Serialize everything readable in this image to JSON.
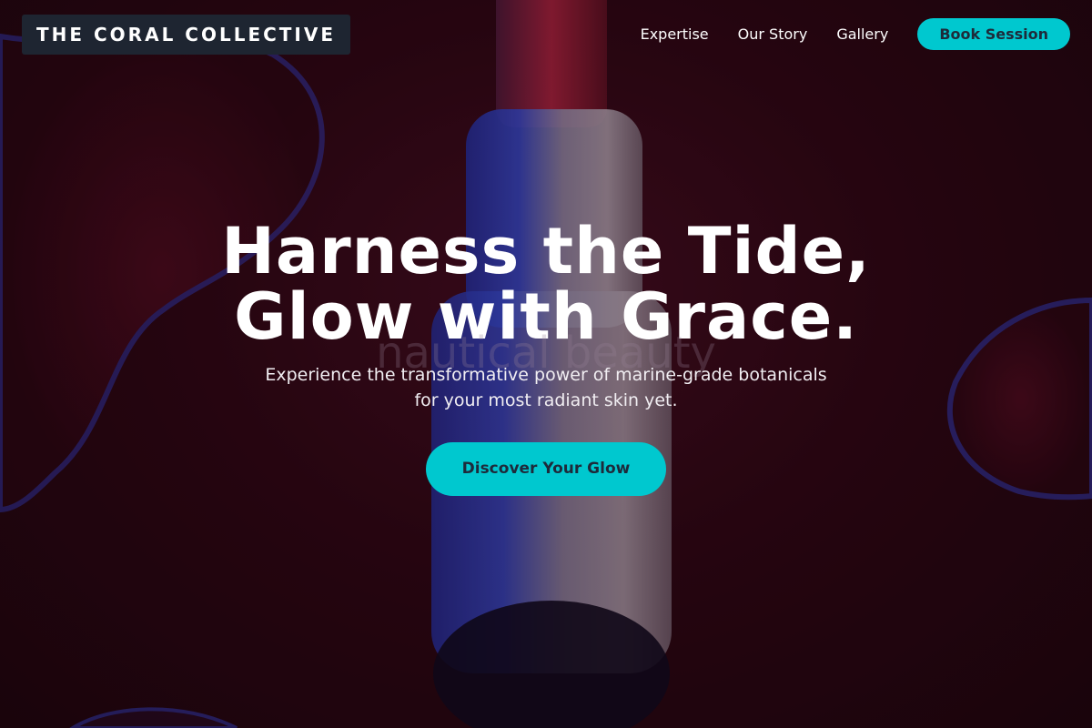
{
  "brand": {
    "logo_text": "THE CORAL COLLECTIVE"
  },
  "nav": {
    "links": [
      "Expertise",
      "Our Story",
      "Gallery"
    ],
    "cta_label": "Book Session"
  },
  "hero": {
    "headline_line1": "Harness the Tide,",
    "headline_line2": "Glow with Grace.",
    "watermark_text": "nautical beauty",
    "subtitle_line1": "Experience the transformative power of marine-grade botanicals",
    "subtitle_line2": "for your most radiant skin yet.",
    "cta_label": "Discover Your Glow"
  },
  "colors": {
    "accent": "#00c8cf",
    "logo_bg": "#1e2531",
    "button_text": "#1e2a3a",
    "background": "#24050f"
  }
}
